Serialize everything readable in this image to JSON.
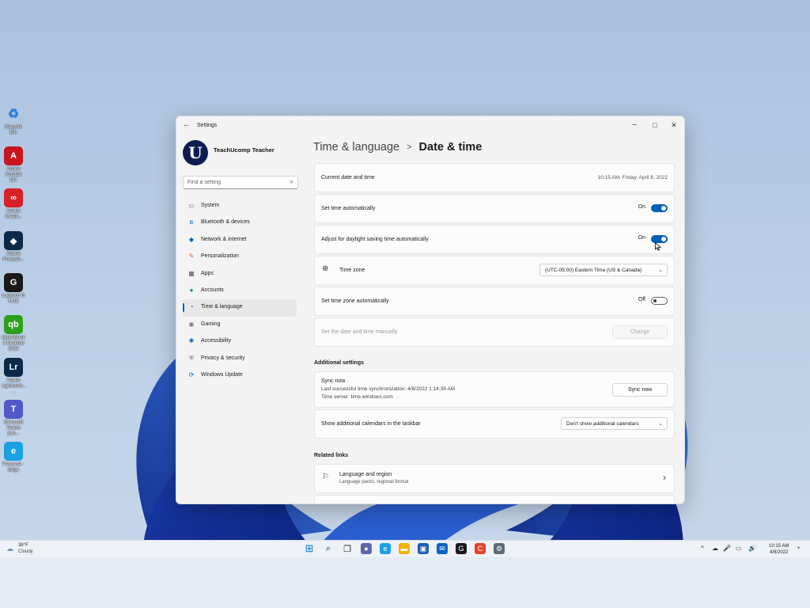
{
  "desktop": {
    "icons": [
      {
        "name": "recycle-bin-icon",
        "label": "Recycle Bin",
        "glyph": "♻",
        "color": "#ffffff"
      },
      {
        "name": "adobe-acrobat-icon",
        "label": "Adobe Acrobat DC",
        "glyph": "A",
        "color": "#c8161d"
      },
      {
        "name": "adobe-creative-cloud-icon",
        "label": "Adobe Creati...",
        "glyph": "∞",
        "color": "#da1f26"
      },
      {
        "name": "adobe-photoshop-icon",
        "label": "Adobe Photosh...",
        "glyph": "◆",
        "color": "#0b2a4a"
      },
      {
        "name": "logitech-ghub-icon",
        "label": "Logitech G HUB",
        "glyph": "G",
        "color": "#1a1a1a"
      },
      {
        "name": "quickbooks-icon",
        "label": "QuickBooks Desktop 2022",
        "glyph": "qb",
        "color": "#2ca01c"
      },
      {
        "name": "adobe-lightroom-icon",
        "label": "Adobe Lightroom...",
        "glyph": "Lr",
        "color": "#0b2a4a"
      },
      {
        "name": "microsoft-teams-icon",
        "label": "Microsoft Teams (wo...",
        "glyph": "T",
        "color": "#5059c9"
      },
      {
        "name": "edge-icon",
        "label": "Personal - Edge",
        "glyph": "e",
        "color": "#1ba1e2"
      }
    ]
  },
  "window": {
    "app_title": "Settings",
    "minimize": "–",
    "maximize": "□",
    "close": "✕",
    "back": "←"
  },
  "profile": {
    "initial": "U",
    "name": "TeachUcomp Teacher"
  },
  "search": {
    "placeholder": "Find a setting",
    "icon": "⌕"
  },
  "nav": [
    {
      "label": "System",
      "icon": "▭",
      "color": "#0067c0",
      "active": false
    },
    {
      "label": "Bluetooth & devices",
      "icon": "ʙ",
      "color": "#0067c0",
      "active": false
    },
    {
      "label": "Network & internet",
      "icon": "◆",
      "color": "#0067c0",
      "active": false
    },
    {
      "label": "Personalization",
      "icon": "✎",
      "color": "#d5662a",
      "active": false
    },
    {
      "label": "Apps",
      "icon": "▦",
      "color": "#555555",
      "active": false
    },
    {
      "label": "Accounts",
      "icon": "●",
      "color": "#1a8a5a",
      "active": false
    },
    {
      "label": "Time & language",
      "icon": "◔",
      "color": "#0067c0",
      "active": true
    },
    {
      "label": "Gaming",
      "icon": "◉",
      "color": "#777777",
      "active": false
    },
    {
      "label": "Accessibility",
      "icon": "✱",
      "color": "#0067c0",
      "active": false
    },
    {
      "label": "Privacy & security",
      "icon": "⛨",
      "color": "#777777",
      "active": false
    },
    {
      "label": "Windows Update",
      "icon": "⟳",
      "color": "#0067c0",
      "active": false
    }
  ],
  "heading": {
    "parent": "Time & language",
    "separator": ">",
    "current": "Date & time"
  },
  "cards": {
    "current": {
      "label": "Current date and time",
      "value": "10:15 AM, Friday, April 8, 2022"
    },
    "auto_time": {
      "label": "Set time automatically",
      "state": "On"
    },
    "dst": {
      "label": "Adjust for daylight saving time automatically",
      "state": "On"
    },
    "timezone": {
      "label": "Time zone",
      "icon": "⊕",
      "value": "(UTC-05:00) Eastern Time (US & Canada)"
    },
    "auto_tz": {
      "label": "Set time zone automatically",
      "state": "Off"
    },
    "manual": {
      "label": "Set the date and time manually",
      "button": "Change"
    }
  },
  "additional": {
    "title": "Additional settings",
    "sync": {
      "title": "Sync now",
      "last_sync": "Last successful time synchronization: 4/8/2022 1:14:39 AM",
      "server": "Time server: time.windows.com",
      "button": "Sync now"
    },
    "calendars": {
      "label": "Show additional calendars in the taskbar",
      "value": "Don't show additional calendars"
    }
  },
  "related": {
    "title": "Related links",
    "language": {
      "title": "Language and region",
      "subtitle": "Language packs, regional format",
      "chevron": "›"
    }
  },
  "taskbar": {
    "weather": {
      "temp": "38°F",
      "condition": "Cloudy"
    },
    "apps": [
      {
        "name": "start-icon",
        "glyph": "⊞",
        "color": "#0078d4"
      },
      {
        "name": "search-icon",
        "glyph": "⌕",
        "color": "#1a1a1a"
      },
      {
        "name": "task-view-icon",
        "glyph": "❐",
        "color": "#1a1a1a"
      },
      {
        "name": "chat-icon",
        "glyph": "●",
        "color": "#6264a7"
      },
      {
        "name": "edge-taskbar-icon",
        "glyph": "e",
        "color": "#1ba1e2"
      },
      {
        "name": "file-explorer-icon",
        "glyph": "▬",
        "color": "#f2b200"
      },
      {
        "name": "store-icon",
        "glyph": "▣",
        "color": "#1a5fb4"
      },
      {
        "name": "mail-icon",
        "glyph": "✉",
        "color": "#0a64c8"
      },
      {
        "name": "ghub-taskbar-icon",
        "glyph": "G",
        "color": "#1a1a1a"
      },
      {
        "name": "camtasia-icon",
        "glyph": "C",
        "color": "#e0452a"
      },
      {
        "name": "settings-taskbar-icon",
        "glyph": "⚙",
        "color": "#5a6a7a"
      }
    ],
    "tray": [
      "^",
      "☁",
      "🎤",
      "▭",
      "🔊"
    ],
    "time": "10:15 AM",
    "date": "4/8/2022"
  }
}
